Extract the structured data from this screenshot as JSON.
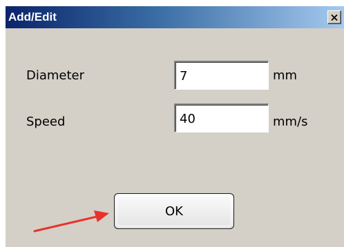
{
  "window": {
    "title": "Add/Edit",
    "close_label": "X"
  },
  "form": {
    "diameter": {
      "label": "Diameter",
      "value": "7",
      "unit": "mm"
    },
    "speed": {
      "label": "Speed",
      "value": "40",
      "unit": "mm/s"
    }
  },
  "buttons": {
    "ok_label": "OK"
  },
  "annotation": {
    "arrow_color": "#e8332a"
  },
  "colors": {
    "dialog_bg": "#d4d0c8",
    "titlebar_start": "#0a246a",
    "titlebar_end": "#a6caf0"
  }
}
